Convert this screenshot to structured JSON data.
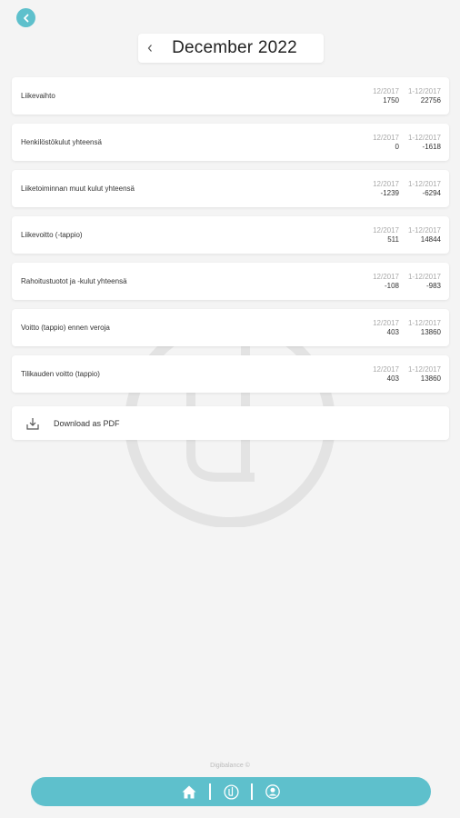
{
  "header": {
    "month_title": "December 2022"
  },
  "report_rows": [
    {
      "label": "Liikevaihto",
      "col1_head": "12/2017",
      "col2_head": "1-12/2017",
      "col1_value": "1750",
      "col2_value": "22756"
    },
    {
      "label": "Henkilöstökulut yhteensä",
      "col1_head": "12/2017",
      "col2_head": "1-12/2017",
      "col1_value": "0",
      "col2_value": "-1618"
    },
    {
      "label": "Liiketoiminnan muut kulut yhteensä",
      "col1_head": "12/2017",
      "col2_head": "1-12/2017",
      "col1_value": "-1239",
      "col2_value": "-6294"
    },
    {
      "label": "Liikevoitto (-tappio)",
      "col1_head": "12/2017",
      "col2_head": "1-12/2017",
      "col1_value": "511",
      "col2_value": "14844"
    },
    {
      "label": "Rahoitustuotot ja -kulut yhteensä",
      "col1_head": "12/2017",
      "col2_head": "1-12/2017",
      "col1_value": "-108",
      "col2_value": "-983"
    },
    {
      "label": "Voitto (tappio) ennen veroja",
      "col1_head": "12/2017",
      "col2_head": "1-12/2017",
      "col1_value": "403",
      "col2_value": "13860"
    },
    {
      "label": "Tilikauden voitto (tappio)",
      "col1_head": "12/2017",
      "col2_head": "1-12/2017",
      "col1_value": "403",
      "col2_value": "13860"
    }
  ],
  "download": {
    "label": "Download as PDF"
  },
  "footer": {
    "text": "Digibalance ©"
  },
  "nav": {
    "items": [
      "home-icon",
      "logo-icon",
      "profile-icon"
    ]
  },
  "colors": {
    "accent": "#5ec0cc",
    "background": "#f4f4f4",
    "card": "#ffffff"
  }
}
